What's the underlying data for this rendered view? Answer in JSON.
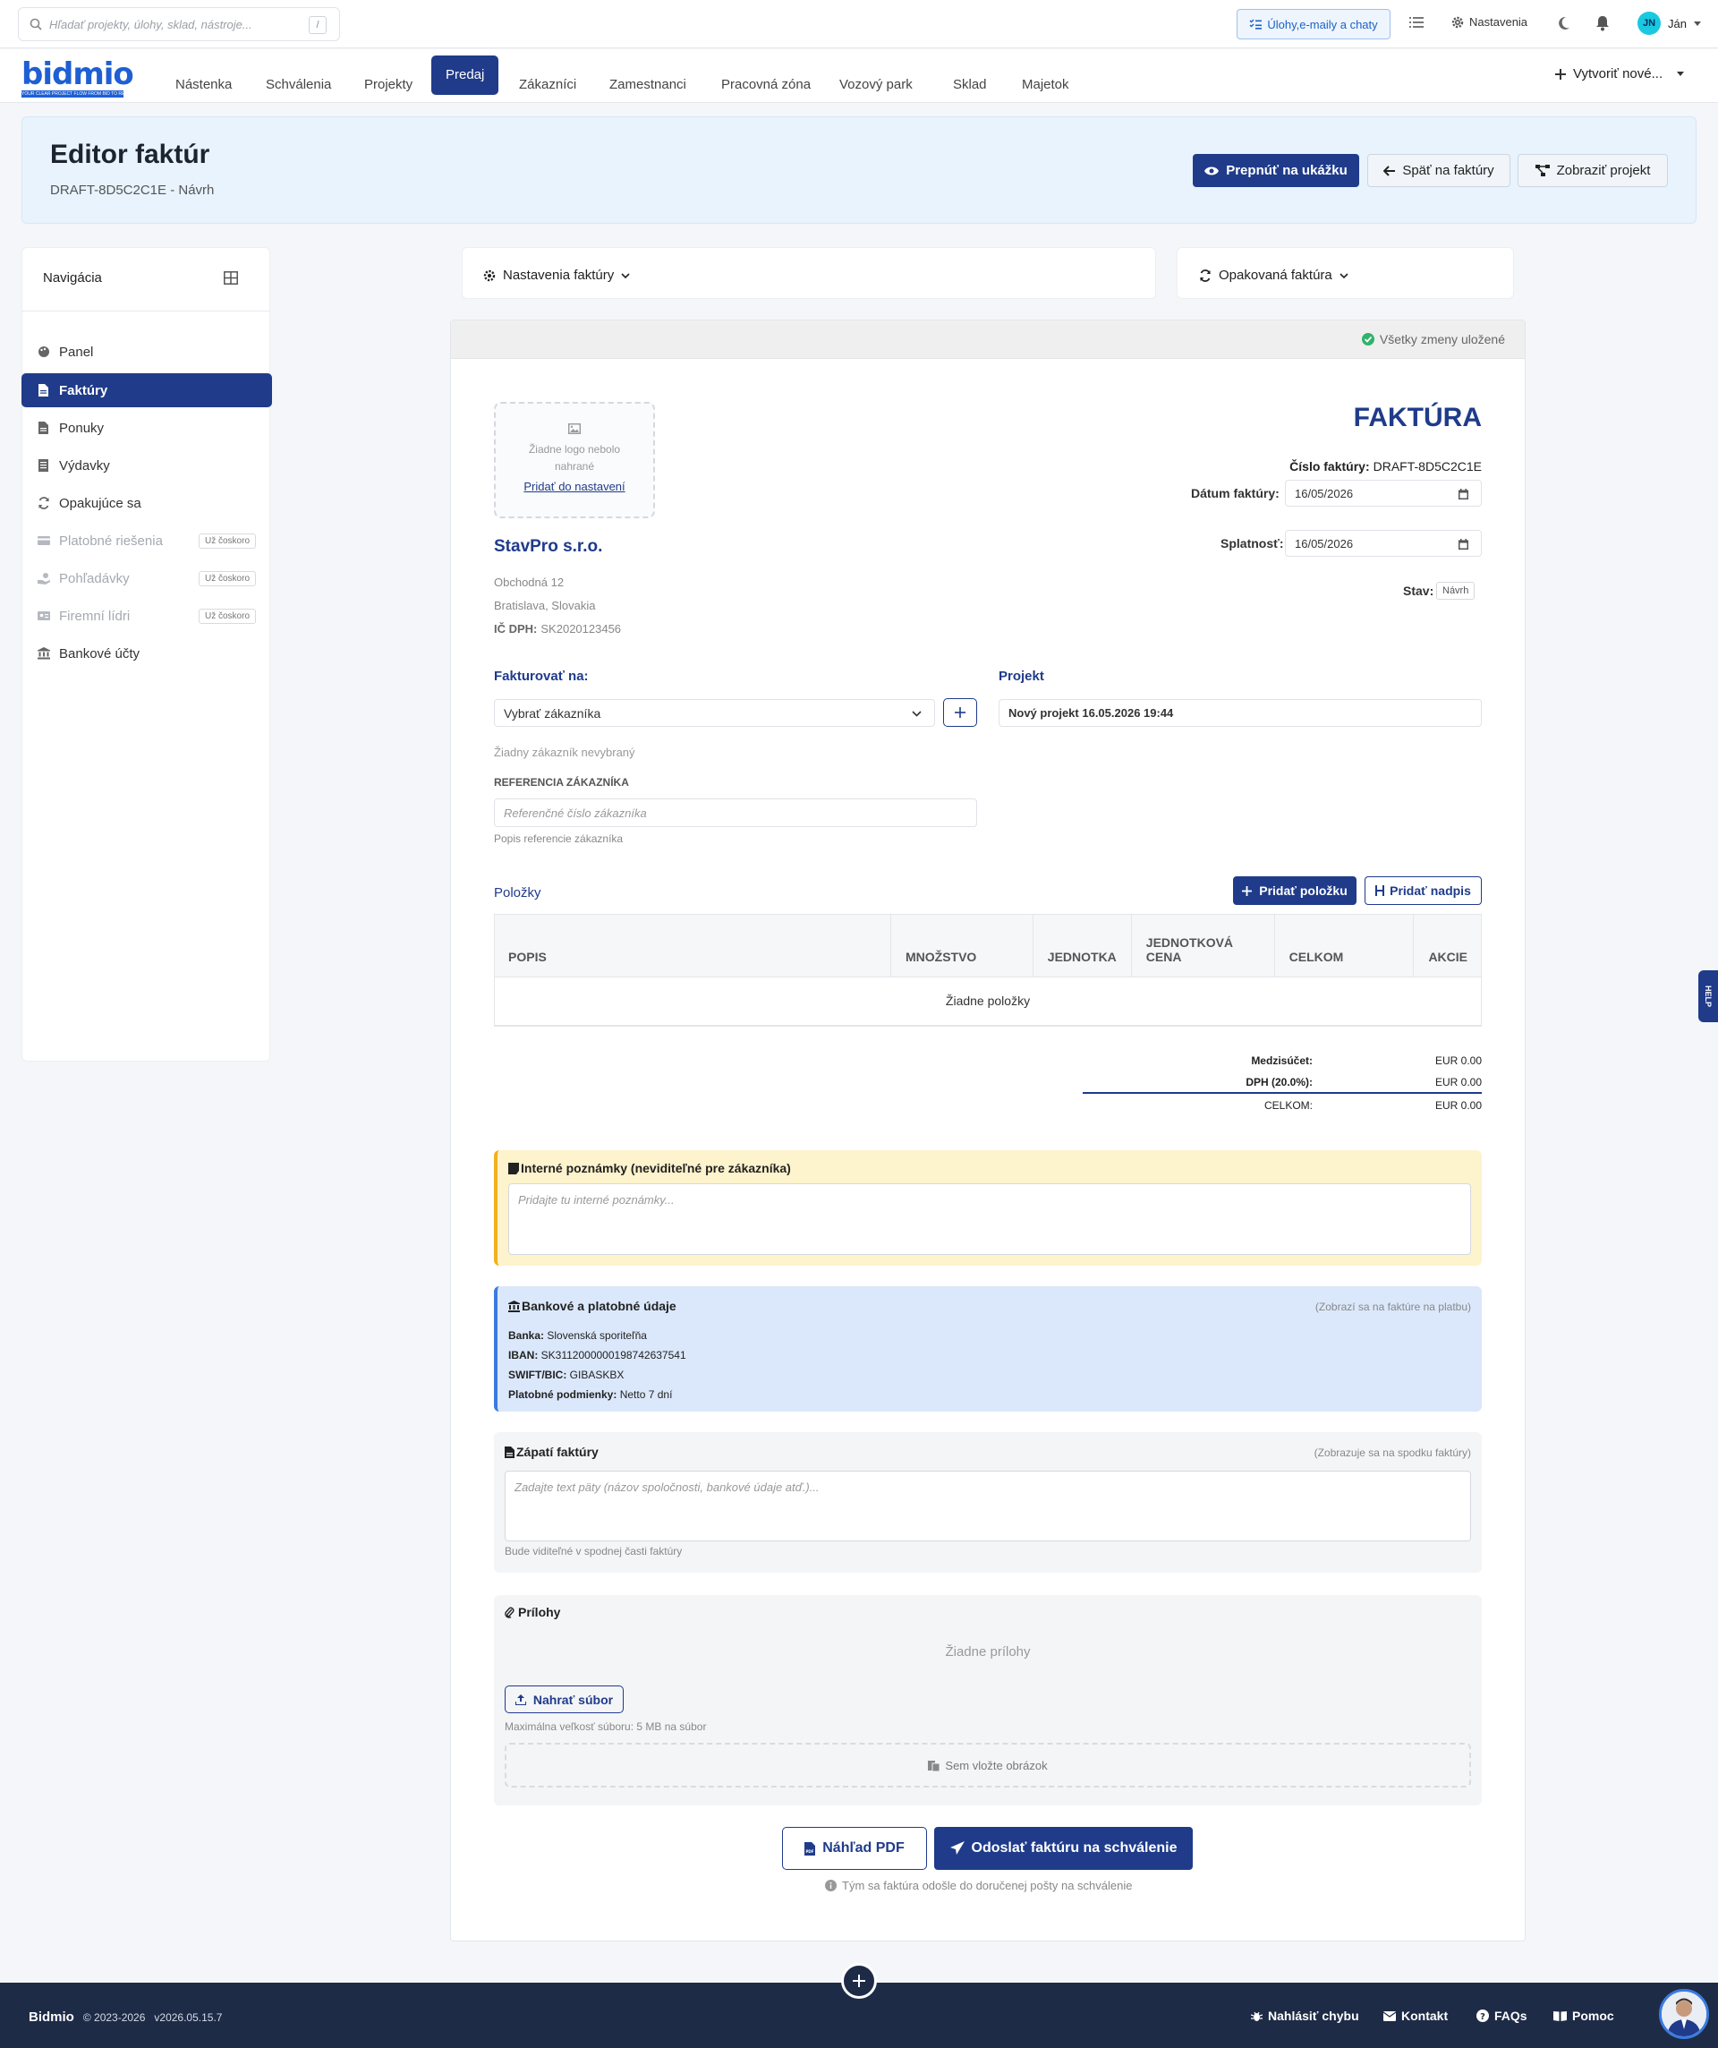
{
  "topbar": {
    "search_placeholder": "Hľadať projekty, úlohy, sklad, nástroje...",
    "search_shortcut": "/",
    "tasks_label": "Úlohy,e-maily a chaty",
    "settings_label": "Nastavenia",
    "user_initials": "JN",
    "user_name": "Ján"
  },
  "logo": {
    "text": "bidmio",
    "tagline": "YOUR CLEAR PROJECT FLOW FROM BID TO RESULT"
  },
  "nav": {
    "items": [
      "Nástenka",
      "Schválenia",
      "Projekty",
      "Predaj",
      "Zákazníci",
      "Zamestnanci",
      "Pracovná zóna",
      "Vozový park",
      "Sklad",
      "Majetok"
    ],
    "active": "Predaj",
    "create_label": "Vytvoriť nové..."
  },
  "header": {
    "title": "Editor faktúr",
    "subtitle": "DRAFT-8D5C2C1E - Návrh",
    "preview_btn": "Prepnúť na ukážku",
    "back_btn": "Späť na faktúry",
    "project_btn": "Zobraziť projekt"
  },
  "sidebar": {
    "title": "Navigácia",
    "items": [
      {
        "label": "Panel",
        "icon": "palette-icon"
      },
      {
        "label": "Faktúry",
        "icon": "file-icon",
        "active": true
      },
      {
        "label": "Ponuky",
        "icon": "file-icon"
      },
      {
        "label": "Výdavky",
        "icon": "receipt-icon"
      },
      {
        "label": "Opakujúce sa",
        "icon": "sync-icon"
      },
      {
        "label": "Platobné riešenia",
        "icon": "card-icon",
        "disabled": true,
        "badge": "Už čoskoro"
      },
      {
        "label": "Pohľadávky",
        "icon": "hand-coin-icon",
        "disabled": true,
        "badge": "Už čoskoro"
      },
      {
        "label": "Firemní lídri",
        "icon": "id-card-icon",
        "disabled": true,
        "badge": "Už čoskoro"
      },
      {
        "label": "Bankové účty",
        "icon": "bank-icon"
      }
    ]
  },
  "settings_cards": {
    "invoice_settings": "Nastavenia faktúry",
    "recurring": "Opakovaná faktúra"
  },
  "invoice": {
    "saved_status": "Všetky zmeny uložené",
    "logo_empty_line1": "Žiadne logo nebolo",
    "logo_empty_line2": "nahrané",
    "logo_add_link": "Pridať do nastavení",
    "heading": "FAKTÚRA",
    "number_label": "Číslo faktúry:",
    "number_value": "DRAFT-8D5C2C1E",
    "date_label": "Dátum faktúry:",
    "date_value": "16/05/2026",
    "due_label": "Splatnosť:",
    "due_value": "16/05/2026",
    "status_label": "Stav:",
    "status_value": "Návrh",
    "company_name": "StavPro s.r.o.",
    "company_street": "Obchodná 12",
    "company_city": "Bratislava, Slovakia",
    "vat_label": "IČ DPH:",
    "vat_value": "SK2020123456",
    "bill_to_label": "Fakturovať na:",
    "customer_select": "Vybrať zákazníka",
    "no_customer": "Žiadny zákazník nevybraný",
    "ref_label": "REFERENCIA ZÁKAZNÍKA",
    "ref_placeholder": "Referenčné číslo zákazníka",
    "ref_help": "Popis referencie zákazníka",
    "project_label": "Projekt",
    "project_value": "Nový projekt 16.05.2026 19:44",
    "items_label": "Položky",
    "add_item_btn": "Pridať položku",
    "add_heading_btn": "Pridať nadpis",
    "table_headers": [
      "POPIS",
      "MNOŽSTVO",
      "JEDNOTKA",
      "JEDNOTKOVÁ CENA",
      "CELKOM",
      "AKCIE"
    ],
    "no_items": "Žiadne položky",
    "subtotal_label": "Medzisúčet:",
    "subtotal_value": "EUR 0.00",
    "vat_total_label": "DPH (20.0%):",
    "vat_total_value": "EUR 0.00",
    "total_label": "CELKOM:",
    "total_value": "EUR 0.00",
    "notes_title": "Interné poznámky (neviditeľné pre zákazníka)",
    "notes_placeholder": "Pridajte tu interné poznámky...",
    "bank_title": "Bankové a platobné údaje",
    "bank_hint": "(Zobrazí sa na faktúre na platbu)",
    "bank_lines": [
      {
        "label": "Banka:",
        "value": "Slovenská sporiteľňa"
      },
      {
        "label": "IBAN:",
        "value": "SK3112000000198742637541"
      },
      {
        "label": "SWIFT/BIC:",
        "value": "GIBASKBX"
      },
      {
        "label": "Platobné podmienky:",
        "value": "Netto 7 dní"
      }
    ],
    "footer_title": "Zápatí faktúry",
    "footer_hint": "(Zobrazuje sa na spodku faktúry)",
    "footer_placeholder": "Zadajte text päty (názov spoločnosti, bankové údaje atď.)...",
    "footer_help": "Bude viditeľné v spodnej časti faktúry",
    "attach_title": "Prílohy",
    "no_attach": "Žiadne prílohy",
    "upload_btn": "Nahrať súbor",
    "max_size": "Maximálna veľkosť súboru: 5 MB na súbor",
    "paste_label": "Sem vložte obrázok",
    "pdf_btn": "Náhľad PDF",
    "send_btn": "Odoslať faktúru na schválenie",
    "send_note": "Tým sa faktúra odošle do doručenej pošty na schválenie"
  },
  "help_tab": "HELP",
  "footer": {
    "brand": "Bidmio",
    "copyright": "© 2023-2026",
    "version": "v2026.05.15.7",
    "links": [
      "Nahlásiť chybu",
      "Kontakt",
      "FAQs",
      "Pomoc"
    ]
  },
  "colors": {
    "primary": "#1f3b8a",
    "header_bg": "#e8f3fd",
    "footer_bg": "#1e2b47",
    "note_bg": "#fdf3cc",
    "bank_bg": "#dbe8fb"
  }
}
